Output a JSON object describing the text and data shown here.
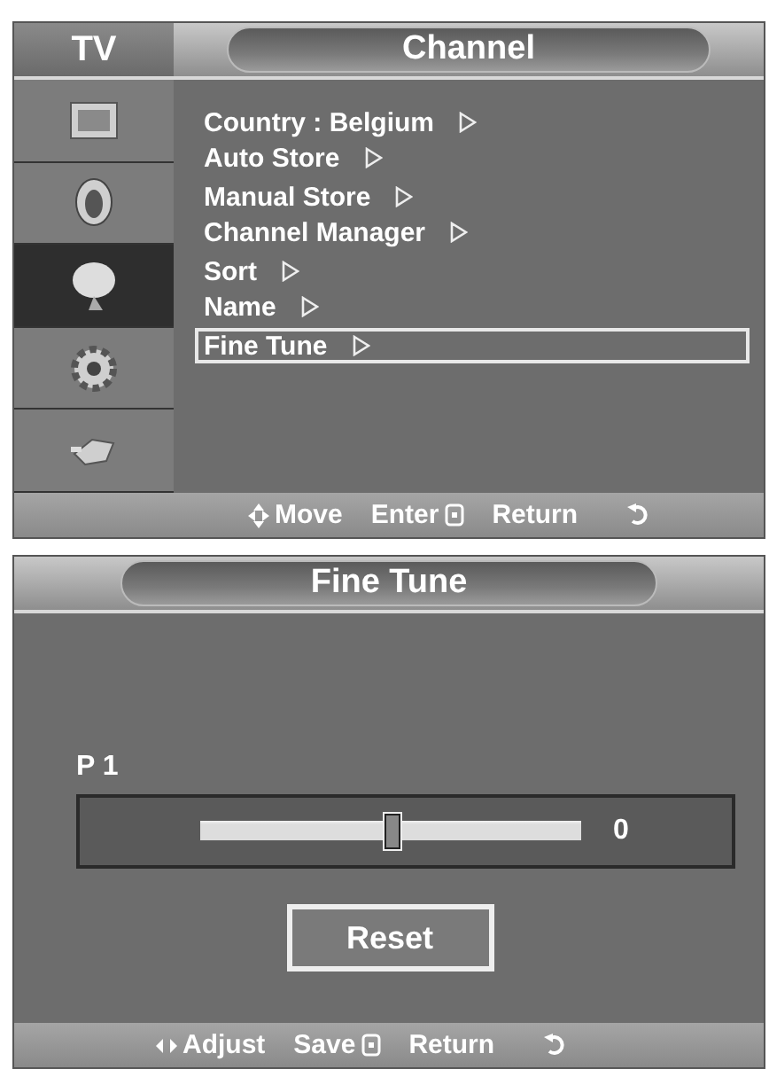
{
  "channel_menu": {
    "section": "TV",
    "title": "Channel",
    "categories": [
      {
        "kind": "picture",
        "selected": false
      },
      {
        "kind": "sound",
        "selected": false
      },
      {
        "kind": "channel",
        "selected": true
      },
      {
        "kind": "setup",
        "selected": false
      },
      {
        "kind": "input",
        "selected": false
      }
    ],
    "items": [
      {
        "label": "Country : Belgium",
        "selected": false
      },
      {
        "label": "Auto Store",
        "selected": false
      },
      {
        "label": "Manual Store",
        "selected": false
      },
      {
        "label": "Channel Manager",
        "selected": false
      },
      {
        "label": "Sort",
        "selected": false
      },
      {
        "label": "Name",
        "selected": false
      },
      {
        "label": "Fine Tune",
        "selected": true
      }
    ],
    "hints": [
      {
        "kind": "move",
        "label": "Move"
      },
      {
        "kind": "enter",
        "label": "Enter"
      },
      {
        "kind": "return",
        "label": "Return"
      }
    ]
  },
  "fine_tune": {
    "title": "Fine Tune",
    "channel": "P 1",
    "level": 0.5,
    "value": "0",
    "button": "Reset",
    "hints": [
      {
        "kind": "adjust",
        "label": "Adjust"
      },
      {
        "kind": "enter",
        "label": "Save"
      },
      {
        "kind": "return",
        "label": "Return"
      }
    ]
  }
}
